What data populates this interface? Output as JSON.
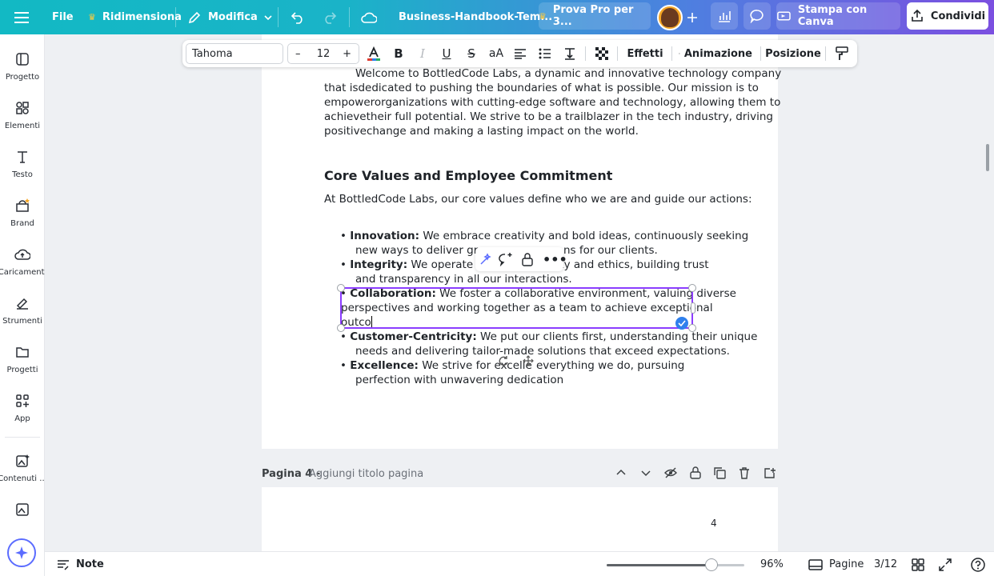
{
  "topbar": {
    "file_label": "File",
    "resize_label": "Ridimensiona",
    "edit_label": "Modifica",
    "doc_title": "Business-Handbook-Tem...",
    "pro_label": "Prova Pro per 3...",
    "print_label": "Stampa con Canva",
    "share_label": "Condividi"
  },
  "sidebar": {
    "items": [
      {
        "label": "Progetto",
        "icon": "layout-icon"
      },
      {
        "label": "Elementi",
        "icon": "shapes-icon"
      },
      {
        "label": "Testo",
        "icon": "text-icon"
      },
      {
        "label": "Brand",
        "icon": "brand-icon"
      },
      {
        "label": "Caricamenti",
        "icon": "upload-cloud-icon"
      },
      {
        "label": "Strumenti",
        "icon": "draw-icon"
      },
      {
        "label": "Progetti",
        "icon": "folder-icon"
      },
      {
        "label": "App",
        "icon": "apps-icon"
      },
      {
        "label": "Contenuti ...",
        "icon": "magic-image-icon"
      }
    ]
  },
  "format_toolbar": {
    "font": "Tahoma",
    "font_size": "12",
    "effects_label": "Effetti",
    "animation_label": "Animazione",
    "position_label": "Posizione",
    "text_color": "#e03c31"
  },
  "document": {
    "intro": [
      "Welcome to BottledCode Labs, a dynamic and innovative technology company",
      "that isdedicated to pushing the boundaries of what is possible. Our mission is to",
      "empowerorganizations with cutting-edge software and technology, allowing them to",
      "achievetheir full potential. We strive to be a trailblazer in the tech industry, driving",
      "positivechange and making a lasting impact on the world."
    ],
    "heading": "Core Values and Employee Commitment",
    "lead": "At BottledCode Labs, our core values define who we are and guide our actions:",
    "values": [
      {
        "title": "Innovation:",
        "line1": " We embrace creativity and bold ideas, continuously seeking",
        "line2": "new ways to deliver grour",
        "line2b": "ns for our clients."
      },
      {
        "title": "Integrity:",
        "line1": " We operate wit",
        "line1b": "rity and ethics, building trust",
        "line2": "and transparency in all our interactions."
      },
      {
        "title": "Collaboration:",
        "line1": " We foster a collaborative environment, valuing diverse",
        "line2": "perspectives and working together as a team to achieve exceptional",
        "line3": "outco"
      },
      {
        "title": "Customer-Centricity:",
        "line1": " We put our clients first, understanding their unique",
        "line2": "needs and delivering tailor-made solutions that exceed expectations."
      },
      {
        "title": "Excellence:",
        "line1": " We strive for excelle",
        "line1b": " everything we do, pursuing",
        "line2": "perfection with unwavering dedication"
      }
    ]
  },
  "page4": {
    "label": "Pagina 4 -",
    "placeholder": "Aggiungi titolo pagina",
    "number": "4"
  },
  "bottombar": {
    "notes_label": "Note",
    "zoom": "96%",
    "pages_label": "Pagine",
    "page_count": "3/12",
    "zoom_fraction": 0.76
  },
  "colors": {
    "selection": "#8b3dff",
    "accent": "#7d2ae8"
  }
}
